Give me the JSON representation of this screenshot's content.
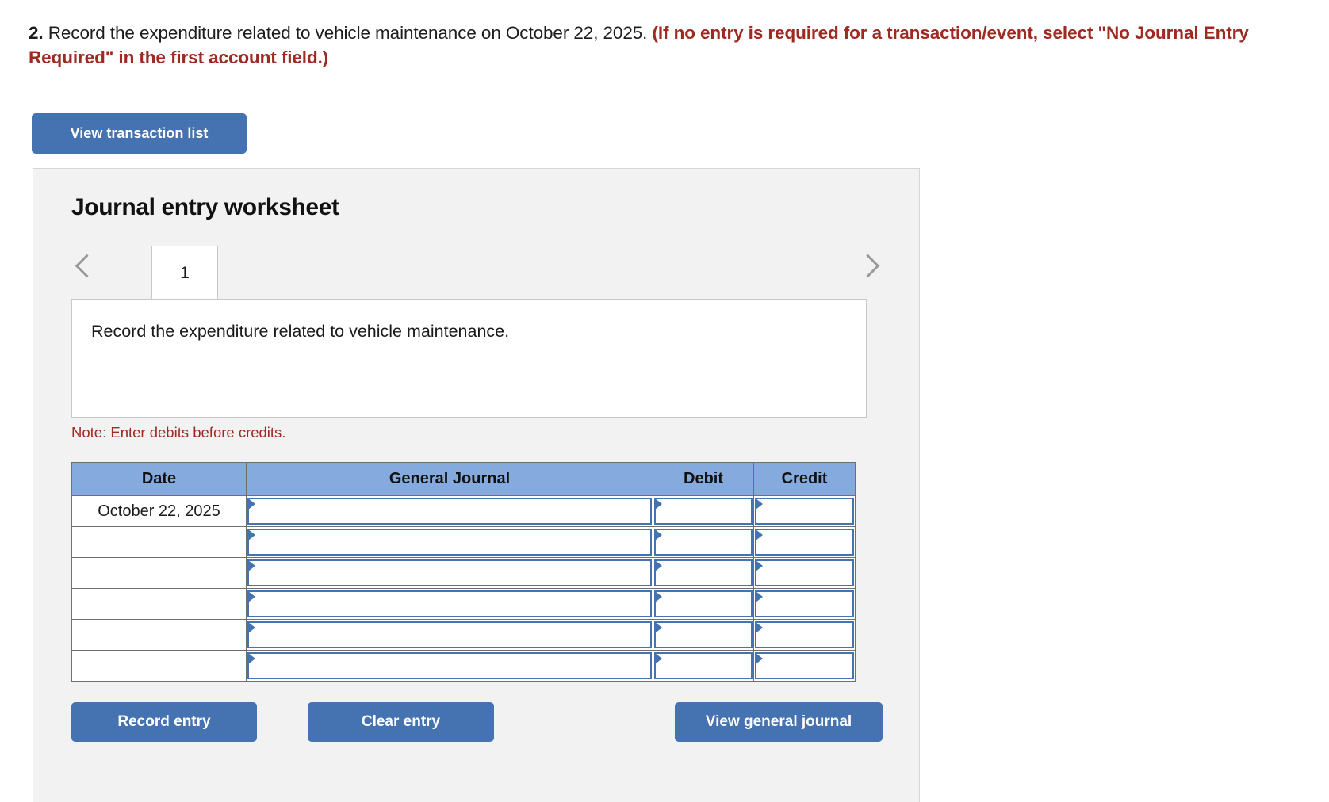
{
  "question": {
    "number": "2.",
    "text": " Record the expenditure related to vehicle maintenance on October 22, 2025. ",
    "note_red": "(If no entry is required for a transaction/event, select \"No Journal Entry Required\" in the first account field.)"
  },
  "toolbar": {
    "view_transaction_list_label": "View transaction list"
  },
  "worksheet": {
    "title": "Journal entry worksheet",
    "tabs": [
      "1"
    ],
    "active_tab": "1",
    "prev_icon": "chevron-left-icon",
    "next_icon": "chevron-right-icon",
    "description": "Record the expenditure related to vehicle maintenance.",
    "note": "Note: Enter debits before credits.",
    "table": {
      "headers": [
        "Date",
        "General Journal",
        "Debit",
        "Credit"
      ],
      "rows": [
        {
          "date": "October 22, 2025",
          "general_journal": "",
          "debit": "",
          "credit": ""
        },
        {
          "date": "",
          "general_journal": "",
          "debit": "",
          "credit": ""
        },
        {
          "date": "",
          "general_journal": "",
          "debit": "",
          "credit": ""
        },
        {
          "date": "",
          "general_journal": "",
          "debit": "",
          "credit": ""
        },
        {
          "date": "",
          "general_journal": "",
          "debit": "",
          "credit": ""
        },
        {
          "date": "",
          "general_journal": "",
          "debit": "",
          "credit": ""
        }
      ]
    },
    "actions": {
      "record_label": "Record entry",
      "clear_label": "Clear entry",
      "view_journal_label": "View general journal"
    }
  },
  "colors": {
    "primary_button": "#4572b0",
    "table_header": "#85aade",
    "red_text": "#9e2a22",
    "panel_bg": "#f2f2f2"
  }
}
